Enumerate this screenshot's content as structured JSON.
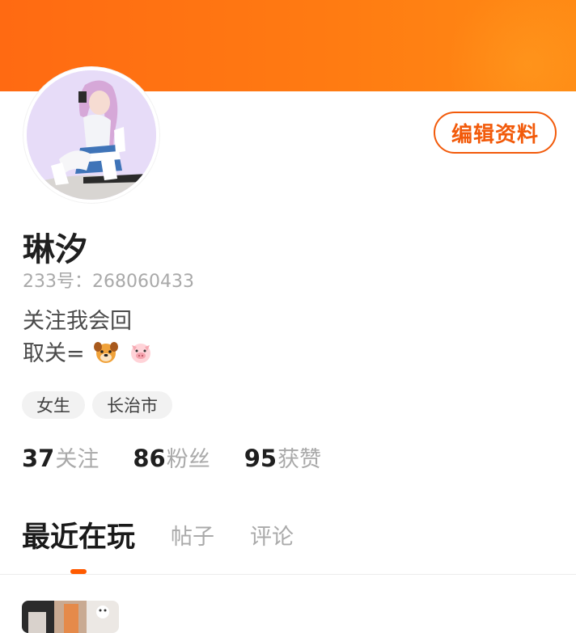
{
  "header": {
    "banner_color": "#ff7a12"
  },
  "profile": {
    "username": "琳汐",
    "uid_label": "233号：268060433",
    "bio_line1": "关注我会回",
    "bio_line2": "取关=",
    "bio_emojis": [
      "dog-face-icon",
      "pig-face-icon"
    ],
    "tags": [
      "女生",
      "长治市"
    ]
  },
  "actions": {
    "edit_label": "编辑资料"
  },
  "stats": [
    {
      "num": "37",
      "label": "关注"
    },
    {
      "num": "86",
      "label": "粉丝"
    },
    {
      "num": "95",
      "label": "获赞"
    }
  ],
  "tabs": [
    {
      "label": "最近在玩",
      "active": true
    },
    {
      "label": "帖子",
      "active": false
    },
    {
      "label": "评论",
      "active": false
    }
  ],
  "colors": {
    "accent": "#f25a0a",
    "indicator": "#ff5a00",
    "muted": "#a9a9a9"
  }
}
